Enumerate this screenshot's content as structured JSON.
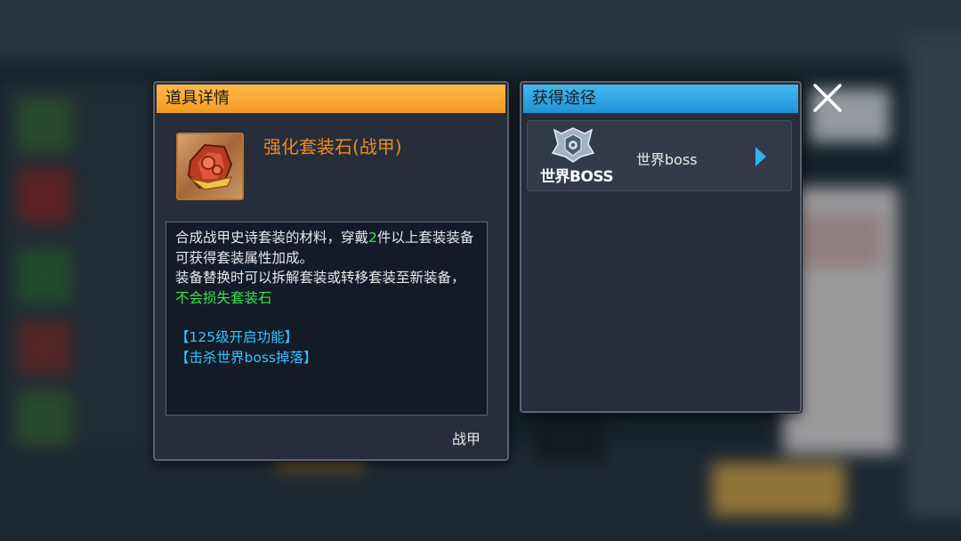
{
  "colors": {
    "item_header": "#f4a02c",
    "source_header": "#2fa6e4",
    "item_name": "#f08a1c",
    "highlight_green": "#3fe04a",
    "source_cyan": "#35c4ff"
  },
  "item_panel": {
    "title": "道具详情",
    "item_name": "强化套装石(战甲)",
    "icon": "armor-set-stone-icon",
    "description": {
      "line1_before": "合成战甲史诗套装的材料，穿戴",
      "line1_count": "2",
      "line1_after": "件以上套装装备可获得套装属性加成。",
      "line2_before": "装备替换时可以拆解套装或转移套装至新装备，",
      "line2_green": "不会损失套装石",
      "source_1": "【125级开启功能】",
      "source_2": "【击杀世界boss掉落】"
    },
    "item_type": "战甲"
  },
  "source_panel": {
    "title": "获得途径",
    "sources": [
      {
        "logo_text": "世界BOSS",
        "label": "世界boss",
        "icon": "world-boss-emblem-icon",
        "arrow": "play-arrow-icon"
      }
    ]
  },
  "close_icon": "close-icon"
}
